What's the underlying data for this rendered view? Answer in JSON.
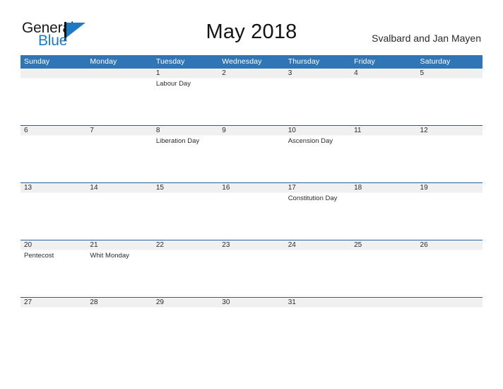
{
  "brand": {
    "name_part1": "General",
    "name_part2": "Blue",
    "mark": "flag-icon",
    "accent_color": "#1f7ac4"
  },
  "header": {
    "title": "May 2018",
    "region": "Svalbard and Jan Mayen"
  },
  "calendar": {
    "header_bg": "#3075b5",
    "row_line_color": "#1f5c99",
    "daynum_band_color": "#f0f0f0",
    "weekday_headers": [
      "Sunday",
      "Monday",
      "Tuesday",
      "Wednesday",
      "Thursday",
      "Friday",
      "Saturday"
    ],
    "weeks": [
      [
        {
          "day": "",
          "event": ""
        },
        {
          "day": "",
          "event": ""
        },
        {
          "day": "1",
          "event": "Labour Day"
        },
        {
          "day": "2",
          "event": ""
        },
        {
          "day": "3",
          "event": ""
        },
        {
          "day": "4",
          "event": ""
        },
        {
          "day": "5",
          "event": ""
        }
      ],
      [
        {
          "day": "6",
          "event": ""
        },
        {
          "day": "7",
          "event": ""
        },
        {
          "day": "8",
          "event": "Liberation Day"
        },
        {
          "day": "9",
          "event": ""
        },
        {
          "day": "10",
          "event": "Ascension Day"
        },
        {
          "day": "11",
          "event": ""
        },
        {
          "day": "12",
          "event": ""
        }
      ],
      [
        {
          "day": "13",
          "event": ""
        },
        {
          "day": "14",
          "event": ""
        },
        {
          "day": "15",
          "event": ""
        },
        {
          "day": "16",
          "event": ""
        },
        {
          "day": "17",
          "event": "Constitution Day"
        },
        {
          "day": "18",
          "event": ""
        },
        {
          "day": "19",
          "event": ""
        }
      ],
      [
        {
          "day": "20",
          "event": "Pentecost"
        },
        {
          "day": "21",
          "event": "Whit Monday"
        },
        {
          "day": "22",
          "event": ""
        },
        {
          "day": "23",
          "event": ""
        },
        {
          "day": "24",
          "event": ""
        },
        {
          "day": "25",
          "event": ""
        },
        {
          "day": "26",
          "event": ""
        }
      ],
      [
        {
          "day": "27",
          "event": ""
        },
        {
          "day": "28",
          "event": ""
        },
        {
          "day": "29",
          "event": ""
        },
        {
          "day": "30",
          "event": ""
        },
        {
          "day": "31",
          "event": ""
        },
        {
          "day": "",
          "event": ""
        },
        {
          "day": "",
          "event": ""
        }
      ]
    ]
  }
}
